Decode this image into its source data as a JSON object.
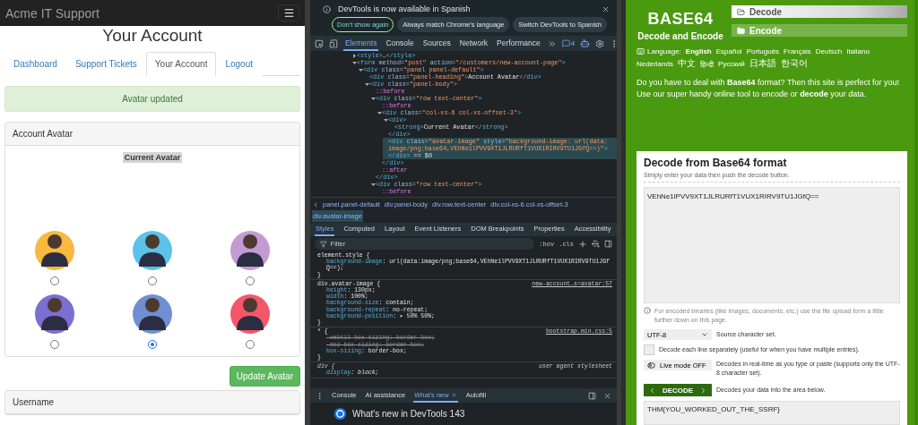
{
  "account_page": {
    "navbar": {
      "brand": "Acme IT Support"
    },
    "heading": "Your Account",
    "tabs": [
      {
        "label": "Dashboard",
        "selected": false
      },
      {
        "label": "Support Tickets",
        "selected": false
      },
      {
        "label": "Your Account",
        "selected": true
      },
      {
        "label": "Logout",
        "selected": false
      }
    ],
    "alert": "Avatar updated",
    "avatar_panel": {
      "title": "Account Avatar",
      "current_label": "Current Avatar",
      "avatars": [
        {
          "color": "#f9b93f",
          "selected": false
        },
        {
          "color": "#5bc3ea",
          "selected": false
        },
        {
          "color": "#c39bd3",
          "selected": false
        },
        {
          "color": "#7b6fd0",
          "selected": false
        },
        {
          "color": "#6f8fd0",
          "selected": true
        },
        {
          "color": "#f5566a",
          "selected": false
        }
      ]
    },
    "update_button": "Update Avatar",
    "username_panel": {
      "title": "Username"
    }
  },
  "devtools": {
    "notice": {
      "text": "DevTools is now available in Spanish",
      "buttons": [
        "Don't show again",
        "Always match Chrome's language",
        "Switch DevTools to Spanish"
      ]
    },
    "tabs": [
      {
        "label": "Elements",
        "selected": true
      },
      {
        "label": "Console",
        "selected": false
      },
      {
        "label": "Sources",
        "selected": false
      },
      {
        "label": "Network",
        "selected": false
      },
      {
        "label": "Performance",
        "selected": false
      }
    ],
    "issues_count": "4",
    "dom_tree": [
      {
        "kind": "element",
        "text": "<style>…</style>",
        "expanded": false,
        "selected": false
      },
      {
        "kind": "element",
        "text": "<form method=\"post\" action=\"/customers/new-account-page\">",
        "expanded": true,
        "selected": false,
        "children": [
          {
            "kind": "element",
            "text": "<div class=\"panel panel-default\">",
            "expanded": true,
            "selected": false,
            "children": [
              {
                "kind": "leaf",
                "text": "<div class=\"panel-heading\">Account Avatar</div>",
                "selected": false
              },
              {
                "kind": "element",
                "text": "<div class=\"panel-body\">",
                "expanded": true,
                "selected": false,
                "children": [
                  {
                    "kind": "leaf",
                    "text": "::before",
                    "selected": false
                  },
                  {
                    "kind": "element",
                    "text": "<div class=\"row text-center\">",
                    "expanded": true,
                    "selected": false,
                    "close": "</div>",
                    "children": [
                      {
                        "kind": "leaf",
                        "text": "::before",
                        "selected": false
                      },
                      {
                        "kind": "element",
                        "text": "<div class=\"col-xs-6 col-xs-offset-3\">",
                        "expanded": true,
                        "selected": false,
                        "close": "</div>",
                        "children": [
                          {
                            "kind": "element",
                            "text": "<div>",
                            "expanded": true,
                            "selected": false,
                            "close": "</div>",
                            "children": [
                              {
                                "kind": "leaf",
                                "text": "<strong>Current Avatar</strong>",
                                "selected": false
                              }
                            ]
                          },
                          {
                            "kind": "leaf",
                            "text": "<div class=\"avatar-image\" style=\"background-image: url(data:image/png;base64,VEhNe1lPVV9XT1JLRURfT1VUX1RIRV9TU1JGfQ==)\"></div> == $0",
                            "selected": true
                          }
                        ]
                      },
                      {
                        "kind": "leaf",
                        "text": "::after",
                        "selected": false
                      }
                    ]
                  },
                  {
                    "kind": "element",
                    "text": "<div class=\"row text-center\">",
                    "expanded": true,
                    "selected": false,
                    "children": [
                      {
                        "kind": "leaf",
                        "text": "::before",
                        "selected": false
                      }
                    ]
                  }
                ]
              }
            ]
          }
        ]
      }
    ],
    "breadcrumbs": [
      {
        "label": "panel.panel-default",
        "selected": false
      },
      {
        "label": "div.panel-body",
        "selected": false
      },
      {
        "label": "div.row.text-center",
        "selected": false
      },
      {
        "label": "div.col-xs-6.col-xs-offset-3",
        "selected": false
      },
      {
        "label": "div.avatar-image",
        "selected": true
      }
    ],
    "style_tabs": [
      {
        "label": "Styles",
        "selected": true
      },
      {
        "label": "Computed",
        "selected": false
      },
      {
        "label": "Layout",
        "selected": false
      },
      {
        "label": "Event Listeners",
        "selected": false
      },
      {
        "label": "DOM Breakpoints",
        "selected": false
      },
      {
        "label": "Properties",
        "selected": false
      },
      {
        "label": "Accessibility",
        "selected": false
      }
    ],
    "filter": {
      "placeholder": "Filter"
    },
    "hov": ":hov",
    "cls": ".cls",
    "rules": [
      {
        "kind": "author",
        "selector": "element.style {",
        "close": "}",
        "props": [
          {
            "text": "background-image: url(data:image/png;base64,VEhNe1lPVV9XT1JLRURfT1VUX1RIRV9TU1JGfQ==);",
            "struck": false
          }
        ]
      },
      {
        "kind": "author",
        "selector": "div.avatar-image {",
        "source": "new-account…s=avatar:57",
        "close": "}",
        "props": [
          {
            "text": "height: 130px;",
            "struck": false
          },
          {
            "text": "width: 100%;",
            "struck": false
          },
          {
            "text": "background-size: contain;",
            "struck": false
          },
          {
            "text": "background-repeat: no-repeat;",
            "struck": false
          },
          {
            "text": "background-position: ▸ 50% 50%;",
            "struck": false
          }
        ]
      },
      {
        "kind": "author",
        "selector": "* {",
        "source": "bootstrap.min.css:5",
        "close": "}",
        "props": [
          {
            "text": "-webkit-box-sizing: border-box;",
            "struck": true
          },
          {
            "text": "-moz-box-sizing: border-box;",
            "struck": true
          },
          {
            "text": "box-sizing: border-box;",
            "struck": false
          }
        ]
      },
      {
        "kind": "user-agent",
        "selector": "div {",
        "source": "user agent stylesheet",
        "props": [
          {
            "text": "display: block;",
            "struck": false
          }
        ]
      }
    ],
    "drawer_tabs": [
      {
        "label": "Console",
        "selected": false
      },
      {
        "label": "AI assistance",
        "selected": false
      },
      {
        "label": "What's new",
        "selected": true
      },
      {
        "label": "Autofill",
        "selected": false
      }
    ],
    "whats_new": "What's new in DevTools 143"
  },
  "base64_site": {
    "logo": {
      "title": "BASE64",
      "subtitle": "Decode and Encode"
    },
    "nav": [
      {
        "label": "Decode",
        "selected": true
      },
      {
        "label": "Encode",
        "selected": false
      }
    ],
    "language_label": "Language:",
    "languages": [
      {
        "label": "English",
        "selected": true
      },
      {
        "label": "Español",
        "selected": false
      },
      {
        "label": "Português",
        "selected": false
      },
      {
        "label": "Français",
        "selected": false
      },
      {
        "label": "Deutsch",
        "selected": false
      },
      {
        "label": "Italiano",
        "selected": false
      },
      {
        "label": "Nederlands",
        "selected": false
      },
      {
        "label": "中文",
        "selected": false
      },
      {
        "label": "हिन्दी",
        "selected": false
      },
      {
        "label": "Русский",
        "selected": false
      },
      {
        "label": "日本語",
        "selected": false
      },
      {
        "label": "한국어",
        "selected": false
      }
    ],
    "intro": "Do you have to deal with **Base64** format? Then this site is perfect for you! Use our super handy online tool to encode or **decode** your data.",
    "card": {
      "title": "Decode from Base64 format",
      "subtitle": "Simply enter your data then push the decode button.",
      "input": "VEhNe1lPVV9XT1JLRURfT1VUX1RIRV9TU1JGfQ==",
      "info": "For encoded binaries (like images, documents, etc.) use the file upload form a little further down on this page.",
      "charset": {
        "value": "UTF-8",
        "label": "Source character set."
      },
      "each_line": {
        "checked": false,
        "label": "Decode each line separately (useful for when you have multiple entries)."
      },
      "live_mode": {
        "on": false,
        "button": "Live mode OFF",
        "label": "Decodes in real-time as you type or paste (supports only the UTF-8 character set)."
      },
      "decode": {
        "button": "DECODE",
        "label": "Decodes your data into the area below."
      },
      "output": "THM{YOU_WORKED_OUT_THE_SSRF}"
    }
  }
}
